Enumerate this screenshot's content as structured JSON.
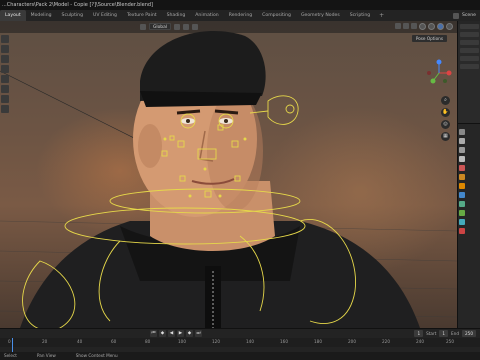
{
  "window": {
    "title": "...Characters\\Pack 2\\Model - Copie [?]\\Source\\Blender.blend]"
  },
  "tabs": [
    {
      "label": "Layout",
      "active": true
    },
    {
      "label": "Modeling"
    },
    {
      "label": "Sculpting"
    },
    {
      "label": "UV Editing"
    },
    {
      "label": "Texture Paint"
    },
    {
      "label": "Shading"
    },
    {
      "label": "Animation"
    },
    {
      "label": "Rendering"
    },
    {
      "label": "Compositing"
    },
    {
      "label": "Geometry Nodes"
    },
    {
      "label": "Scripting"
    }
  ],
  "scene": {
    "label": "Scene"
  },
  "viewport": {
    "orientation": "Global",
    "pose_options": "Pose Options"
  },
  "nav_icons": [
    "zoom-icon",
    "hand-icon",
    "camera-icon",
    "grid-icon"
  ],
  "timeline": {
    "current_frame": "1",
    "start_label": "Start",
    "start": "1",
    "end_label": "End",
    "end": "250",
    "ticks": [
      "0",
      "20",
      "40",
      "60",
      "80",
      "100",
      "120",
      "140",
      "160",
      "180",
      "200",
      "220",
      "240",
      "250"
    ]
  },
  "status": {
    "left": "Select",
    "middle": "Pan View",
    "right": "Show Context Menu"
  },
  "colors": {
    "accent": "#4a6fa8",
    "rig": "#e6d84a",
    "playhead": "#4a8fe8"
  }
}
